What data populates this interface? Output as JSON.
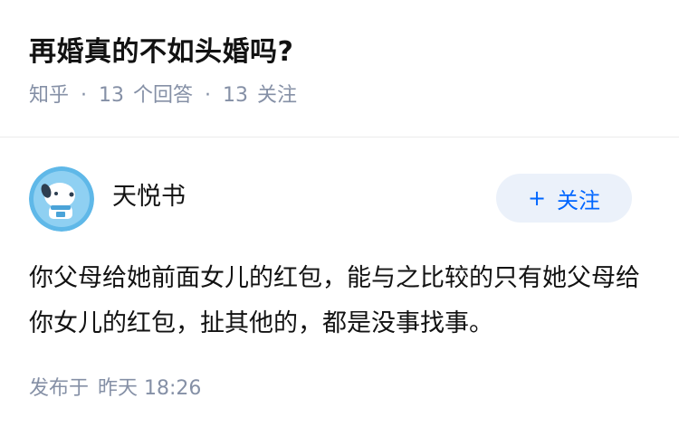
{
  "question": {
    "title": "再婚真的不如头婚吗?",
    "source": "知乎",
    "answers_count": "13",
    "answers_label": "个回答",
    "followers_count": "13",
    "followers_label": "关注"
  },
  "answer": {
    "author_name": "天悦书",
    "avatar_icon": "cartoon-dog-avatar-icon",
    "follow_label": "关注",
    "follow_icon": "plus-icon",
    "body": "你父母给她前面女儿的红包，能与之比较的只有她父母给你女儿的红包，扯其他的，都是没事找事。",
    "posted_label": "发布于",
    "posted_time": "昨天 18:26"
  },
  "colors": {
    "accent": "#0066ff",
    "follow_bg": "#ebf1fa",
    "meta_text": "#8590a6",
    "main_text": "#121212",
    "avatar_bg": "#5fb8e8"
  }
}
